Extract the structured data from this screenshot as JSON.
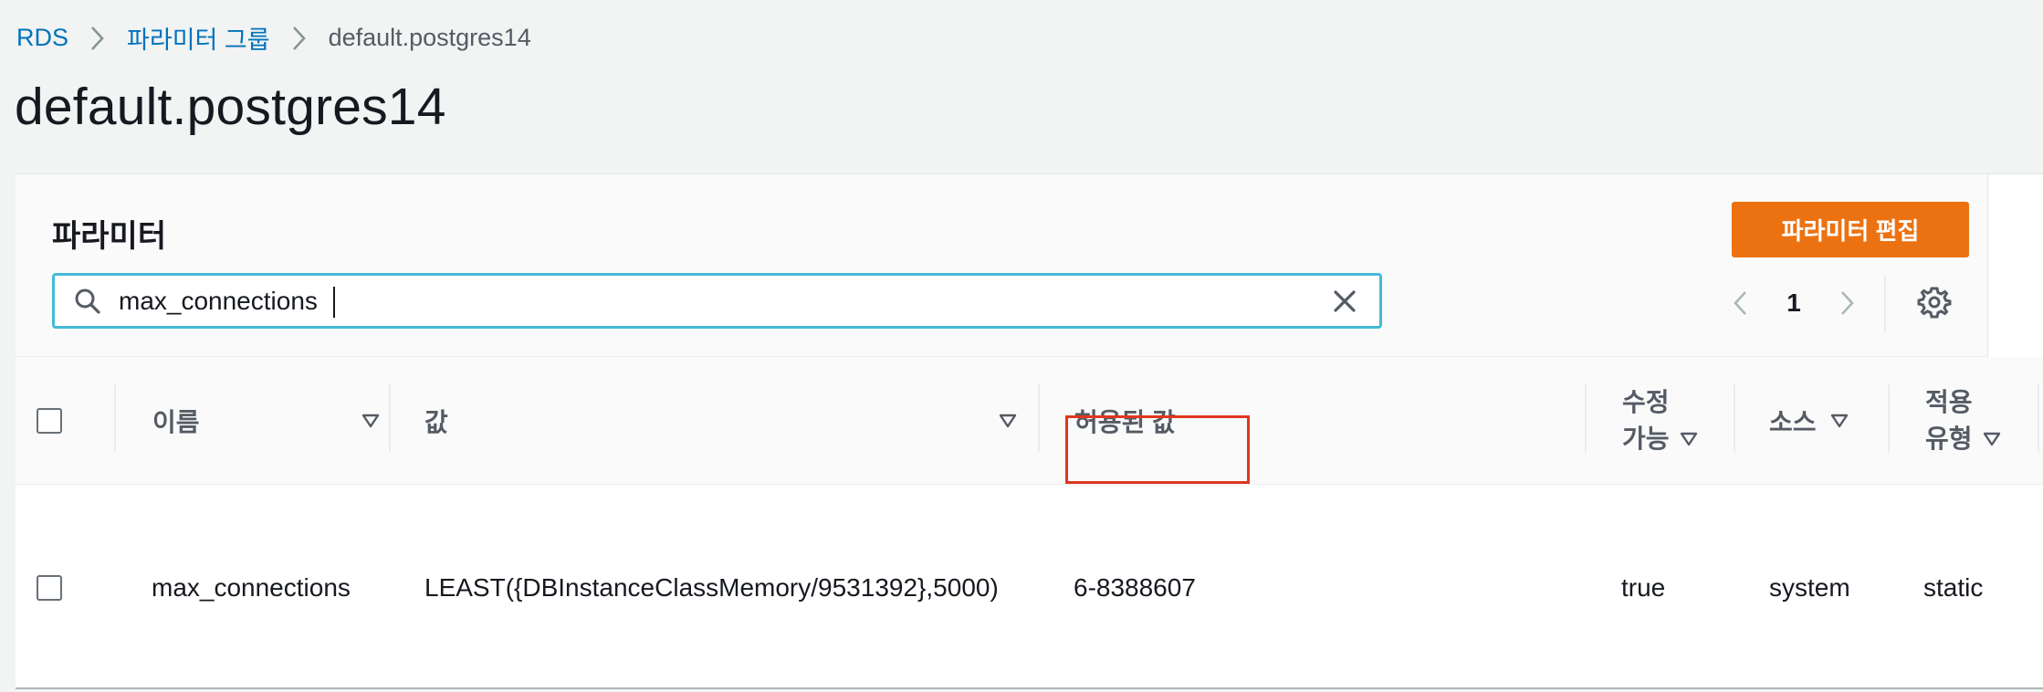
{
  "breadcrumb": {
    "items": [
      {
        "label": "RDS"
      },
      {
        "label": "파라미터 그룹"
      },
      {
        "label": "default.postgres14"
      }
    ]
  },
  "page_title": "default.postgres14",
  "panel": {
    "title": "파라미터",
    "edit_button": "파라미터 편집",
    "search": {
      "value": "max_connections",
      "placeholder": ""
    },
    "pagination": {
      "current_page": "1"
    }
  },
  "table": {
    "columns": [
      {
        "key": "name",
        "label": "이름",
        "sortable": true
      },
      {
        "key": "value",
        "label": "값",
        "sortable": true
      },
      {
        "key": "allowed",
        "label": "허용된 값",
        "sortable": false
      },
      {
        "key": "modifiable",
        "label_line1": "수정",
        "label_line2": "가능",
        "sortable": true
      },
      {
        "key": "source",
        "label": "소스",
        "sortable": true
      },
      {
        "key": "apply_type",
        "label_line1": "적용",
        "label_line2": "유형",
        "sortable": true
      }
    ],
    "rows": [
      {
        "name": "max_connections",
        "value": "LEAST({DBInstanceClassMemory/9531392},5000)",
        "allowed": "6-8388607",
        "modifiable": "true",
        "source": "system",
        "apply_type": "static"
      }
    ]
  },
  "colors": {
    "link": "#0073bb",
    "primary_button": "#ec7211",
    "focus_border": "#44b9d6",
    "annotation_box": "#e0361f"
  }
}
